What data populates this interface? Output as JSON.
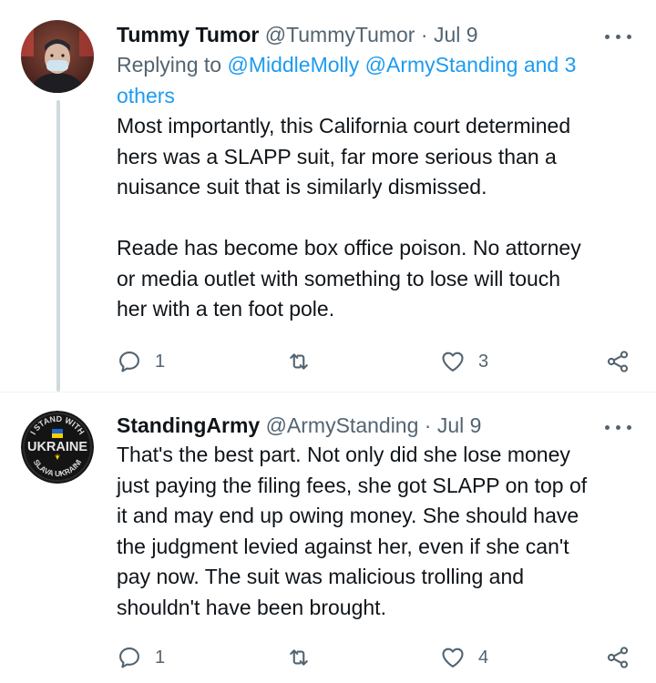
{
  "tweets": [
    {
      "name": "Tummy Tumor",
      "handle": "@TummyTumor",
      "separator": "·",
      "date": "Jul 9",
      "reply_prefix": "Replying to",
      "reply_mentions_line1": "@MiddleMolly @ArmyStanding and 3",
      "reply_mentions_line2": "others",
      "text": "Most importantly, this California court determined\nhers was a SLAPP suit, far more serious than a\nnuisance suit that is similarly dismissed.\n\nReade has become box office poison. No attorney\nor media outlet with something to lose will touch\nher with a ten foot pole.",
      "reply_count": "1",
      "retweet_count": "",
      "like_count": "3",
      "avatar_icon": "person-photo-avatar"
    },
    {
      "name": "StandingArmy",
      "handle": "@ArmyStanding",
      "separator": "·",
      "date": "Jul 9",
      "text": "That's the best part. Not only did she lose money\njust paying the filing fees, she got SLAPP on top of\nit and may end up owing money. She should have\nthe judgment levied against her, even if she can't\npay now. The suit was malicious trolling and\nshouldn't have been brought.",
      "reply_count": "1",
      "retweet_count": "",
      "like_count": "4",
      "avatar": {
        "top_text": "I STAND WITH",
        "center_text": "UKRAINE",
        "bottom_text": "SLAVA UKRAINI"
      }
    }
  ],
  "colors": {
    "text": "#0f1419",
    "secondary": "#536471",
    "link": "#1d9bf0",
    "thread_line": "#cfd9de"
  }
}
